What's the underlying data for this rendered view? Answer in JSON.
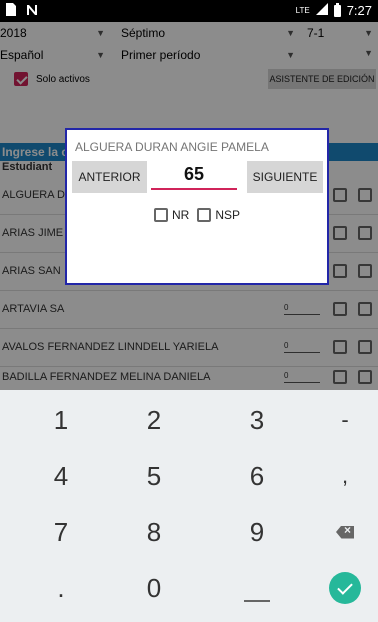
{
  "statusbar": {
    "network": "LTE",
    "time": "7:27"
  },
  "filters": {
    "year": "2018",
    "grade": "Séptimo",
    "section": "7-1",
    "subject": "Español",
    "period": "Primer período",
    "active_only_label": "Solo activos",
    "active_only_checked": true,
    "wizard_button": "ASISTENTE DE EDICIÓN"
  },
  "header": {
    "instruction": "Ingrese la calificación final del período:",
    "column_student": "Estudiant"
  },
  "students": [
    {
      "name": "ALGUERA D",
      "grade": ""
    },
    {
      "name": "ARIAS JIME",
      "grade": ""
    },
    {
      "name": "ARIAS SAN",
      "grade": ""
    },
    {
      "name": "ARTAVIA SA",
      "grade": "0"
    },
    {
      "name": "AVALOS FERNANDEZ LINNDELL YARIELA",
      "grade": "0"
    },
    {
      "name": "BADILLA FERNANDEZ MELINA DANIELA",
      "grade": "0"
    }
  ],
  "dialog": {
    "student_name": "ALGUERA DURAN ANGIE PAMELA",
    "prev_button": "ANTERIOR",
    "next_button": "SIGUIENTE",
    "grade_value": "65",
    "nr_label": "NR",
    "nsp_label": "NSP"
  },
  "keyboard": {
    "keys": [
      "1",
      "2",
      "3",
      "-",
      "4",
      "5",
      "6",
      ",",
      "7",
      "8",
      "9",
      "delete",
      ".",
      "0",
      "space",
      "done"
    ]
  }
}
